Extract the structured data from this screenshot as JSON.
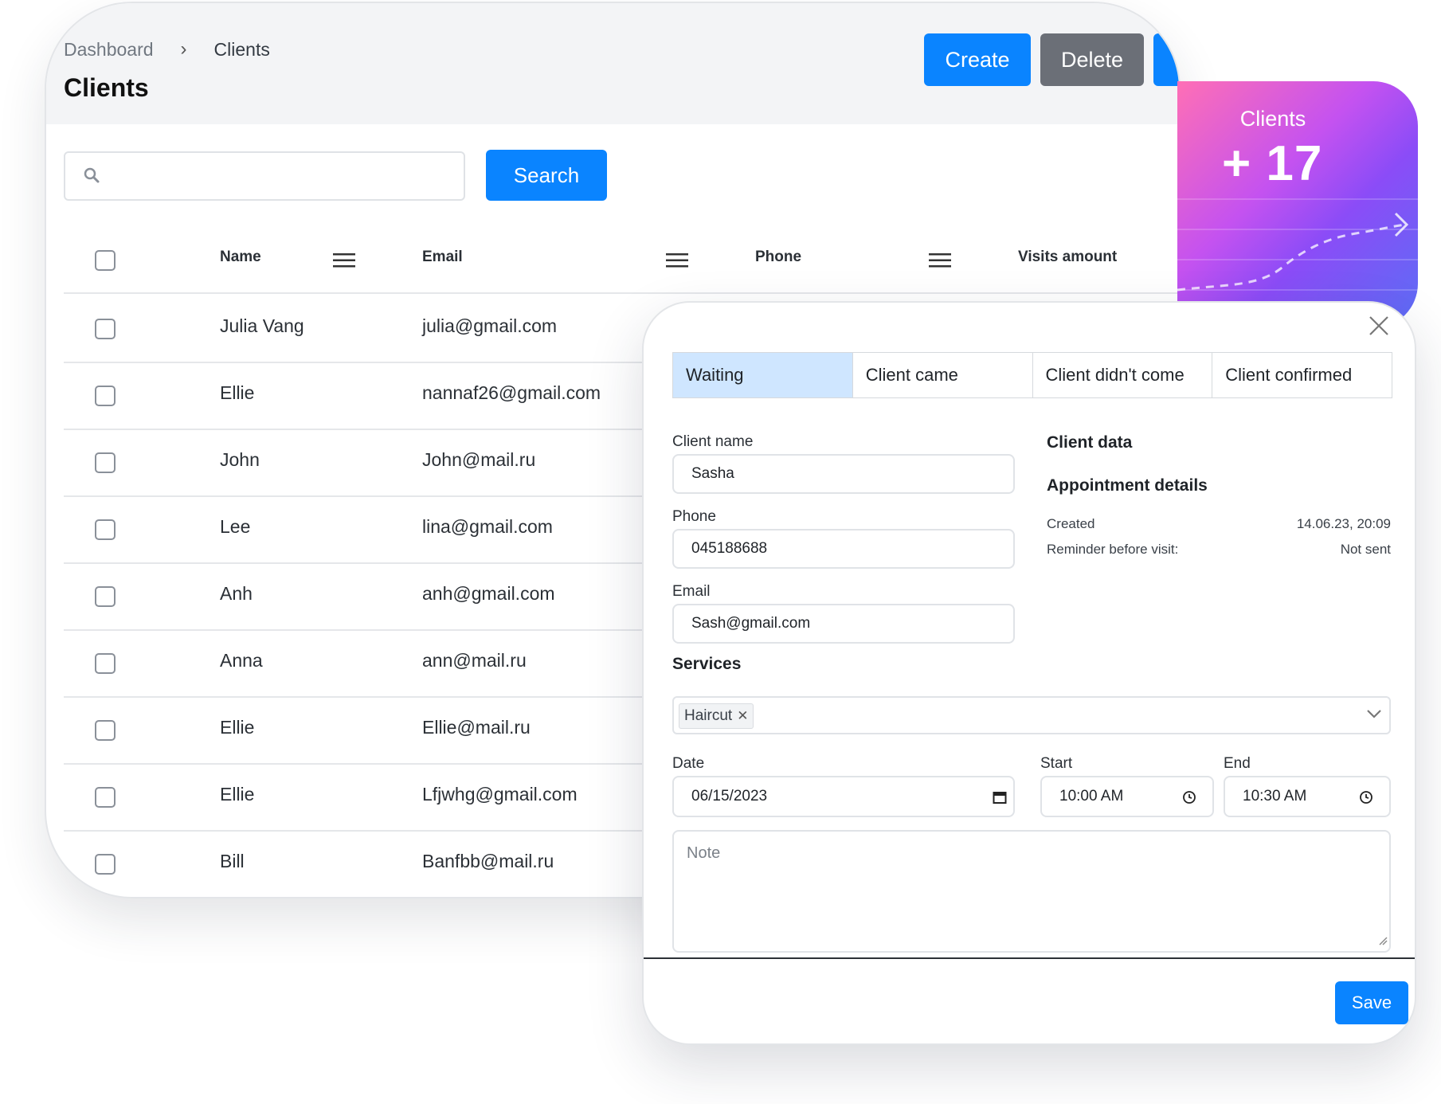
{
  "header": {
    "breadcrumb": {
      "root": "Dashboard",
      "separator": "›",
      "current": "Clients"
    },
    "title": "Clients",
    "create_label": "Create",
    "delete_label": "Delete"
  },
  "search": {
    "button_label": "Search",
    "value": ""
  },
  "table": {
    "columns": [
      "Name",
      "Email",
      "Phone",
      "Visits amount"
    ],
    "rows": [
      {
        "name": "Julia Vang",
        "email": "julia@gmail.com"
      },
      {
        "name": "Ellie",
        "email": "nannaf26@gmail.com"
      },
      {
        "name": "John",
        "email": "John@mail.ru"
      },
      {
        "name": "Lee",
        "email": "lina@gmail.com"
      },
      {
        "name": "Anh",
        "email": "anh@gmail.com"
      },
      {
        "name": "Anna",
        "email": "ann@mail.ru"
      },
      {
        "name": "Ellie",
        "email": "Ellie@mail.ru"
      },
      {
        "name": "Ellie",
        "email": "Lfjwhg@gmail.com"
      },
      {
        "name": "Bill",
        "email": "Banfbb@mail.ru"
      }
    ]
  },
  "stats": {
    "label": "Clients",
    "value": "+ 17"
  },
  "modal": {
    "tabs": [
      "Waiting",
      "Client came",
      "Client didn't come",
      "Client confirmed"
    ],
    "active_tab": "Waiting",
    "client_name": {
      "label": "Client name",
      "value": "Sasha"
    },
    "phone": {
      "label": "Phone",
      "value": "045188688"
    },
    "email": {
      "label": "Email",
      "value": "Sash@gmail.com"
    },
    "client_data_title": "Client data",
    "appointment_title": "Appointment details",
    "created": {
      "label": "Created",
      "value": "14.06.23, 20:09"
    },
    "reminder": {
      "label": "Reminder before visit:",
      "value": "Not sent"
    },
    "services_title": "Services",
    "services_selected": [
      "Haircut"
    ],
    "date": {
      "label": "Date",
      "value": "06/15/2023"
    },
    "start": {
      "label": "Start",
      "value": "10:00 AM"
    },
    "end": {
      "label": "End",
      "value": "10:30 AM"
    },
    "note_placeholder": "Note",
    "save_label": "Save"
  },
  "colors": {
    "primary": "#0a84ff",
    "secondary": "#6b6f77",
    "active_tab": "#cfe6ff",
    "header_bg": "#f3f4f6"
  },
  "icons": [
    "search-icon",
    "menu-icon",
    "close-icon",
    "chevron-down-icon",
    "calendar-icon",
    "clock-icon",
    "chip-remove-icon",
    "arrow-icon"
  ]
}
